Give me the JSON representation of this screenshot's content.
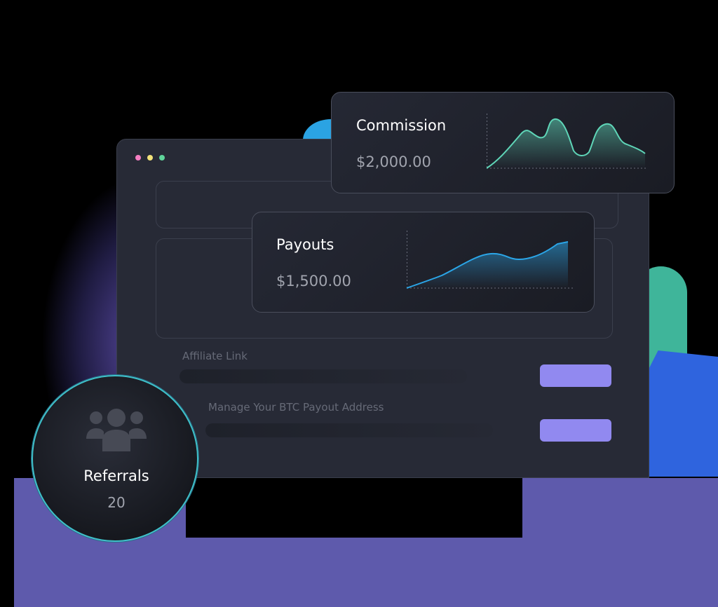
{
  "commission": {
    "title": "Commission",
    "value": "$2,000.00"
  },
  "payouts": {
    "title": "Payouts",
    "value": "$1,500.00"
  },
  "form": {
    "affiliate_label": "Affiliate Link",
    "btc_label": "Manage Your BTC Payout Address"
  },
  "referrals": {
    "label": "Referrals",
    "count": "20",
    "icon": "users-group-icon"
  },
  "window_dots": [
    "#f47ec2",
    "#f2e27a",
    "#5fd49a"
  ],
  "colors": {
    "accent_button": "#9189f0",
    "commission_line": "#5fd6b8",
    "payouts_line": "#2ba6e8",
    "referral_ring": "#3fc1c9"
  }
}
